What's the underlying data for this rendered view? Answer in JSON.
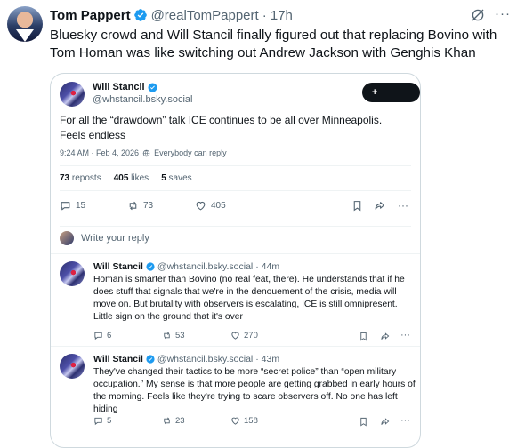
{
  "tweet": {
    "author_name": "Tom Pappert",
    "author_handle": "@realTomPappert",
    "time": "· 17h",
    "text": "Bluesky crowd and Will Stancil finally figured out that replacing Bovino with Tom Homan was like switching out Andrew Jackson with Genghis Khan",
    "more": "···"
  },
  "quoted": {
    "name": "Will Stancil",
    "handle": "@whstancil.bsky.social",
    "follow_label": "+ Follow",
    "text": "For all the “drawdown” talk ICE continues to be all over Minneapolis. Feels endless",
    "timestamp": "9:24 AM · Feb 4, 2026",
    "audience": "Everybody can reply",
    "reposts_count": "73",
    "reposts_label": "reposts",
    "likes_count": "405",
    "likes_label": "likes",
    "saves_count": "5",
    "saves_label": "saves",
    "actions": {
      "replies": "15",
      "reposts": "73",
      "likes": "405"
    },
    "write_reply": "Write your reply",
    "more": "···"
  },
  "replies": [
    {
      "name": "Will Stancil",
      "handle": "@whstancil.bsky.social",
      "time": "· 44m",
      "text": "Homan is smarter than Bovino (no real feat, there). He understands that if he does stuff that signals that we're in the denouement of the crisis, media will move on. But brutality with observers is escalating, ICE is still omnipresent. Little sign on the ground that it's over",
      "comments": "6",
      "reposts": "53",
      "likes": "270",
      "more": "···"
    },
    {
      "name": "Will Stancil",
      "handle": "@whstancil.bsky.social",
      "time": "· 43m",
      "text": "They've changed their tactics to be more “secret police” than “open military occupation.” My sense is that more people are getting grabbed in early hours of the morning. Feels like they're trying to scare observers off. No one has left hiding",
      "comments": "5",
      "reposts": "23",
      "likes": "158",
      "more": "···"
    }
  ],
  "colors": {
    "verified": "#1d9bf0",
    "text": "#0f1419",
    "secondary": "#536471",
    "border": "#cfd9de"
  }
}
